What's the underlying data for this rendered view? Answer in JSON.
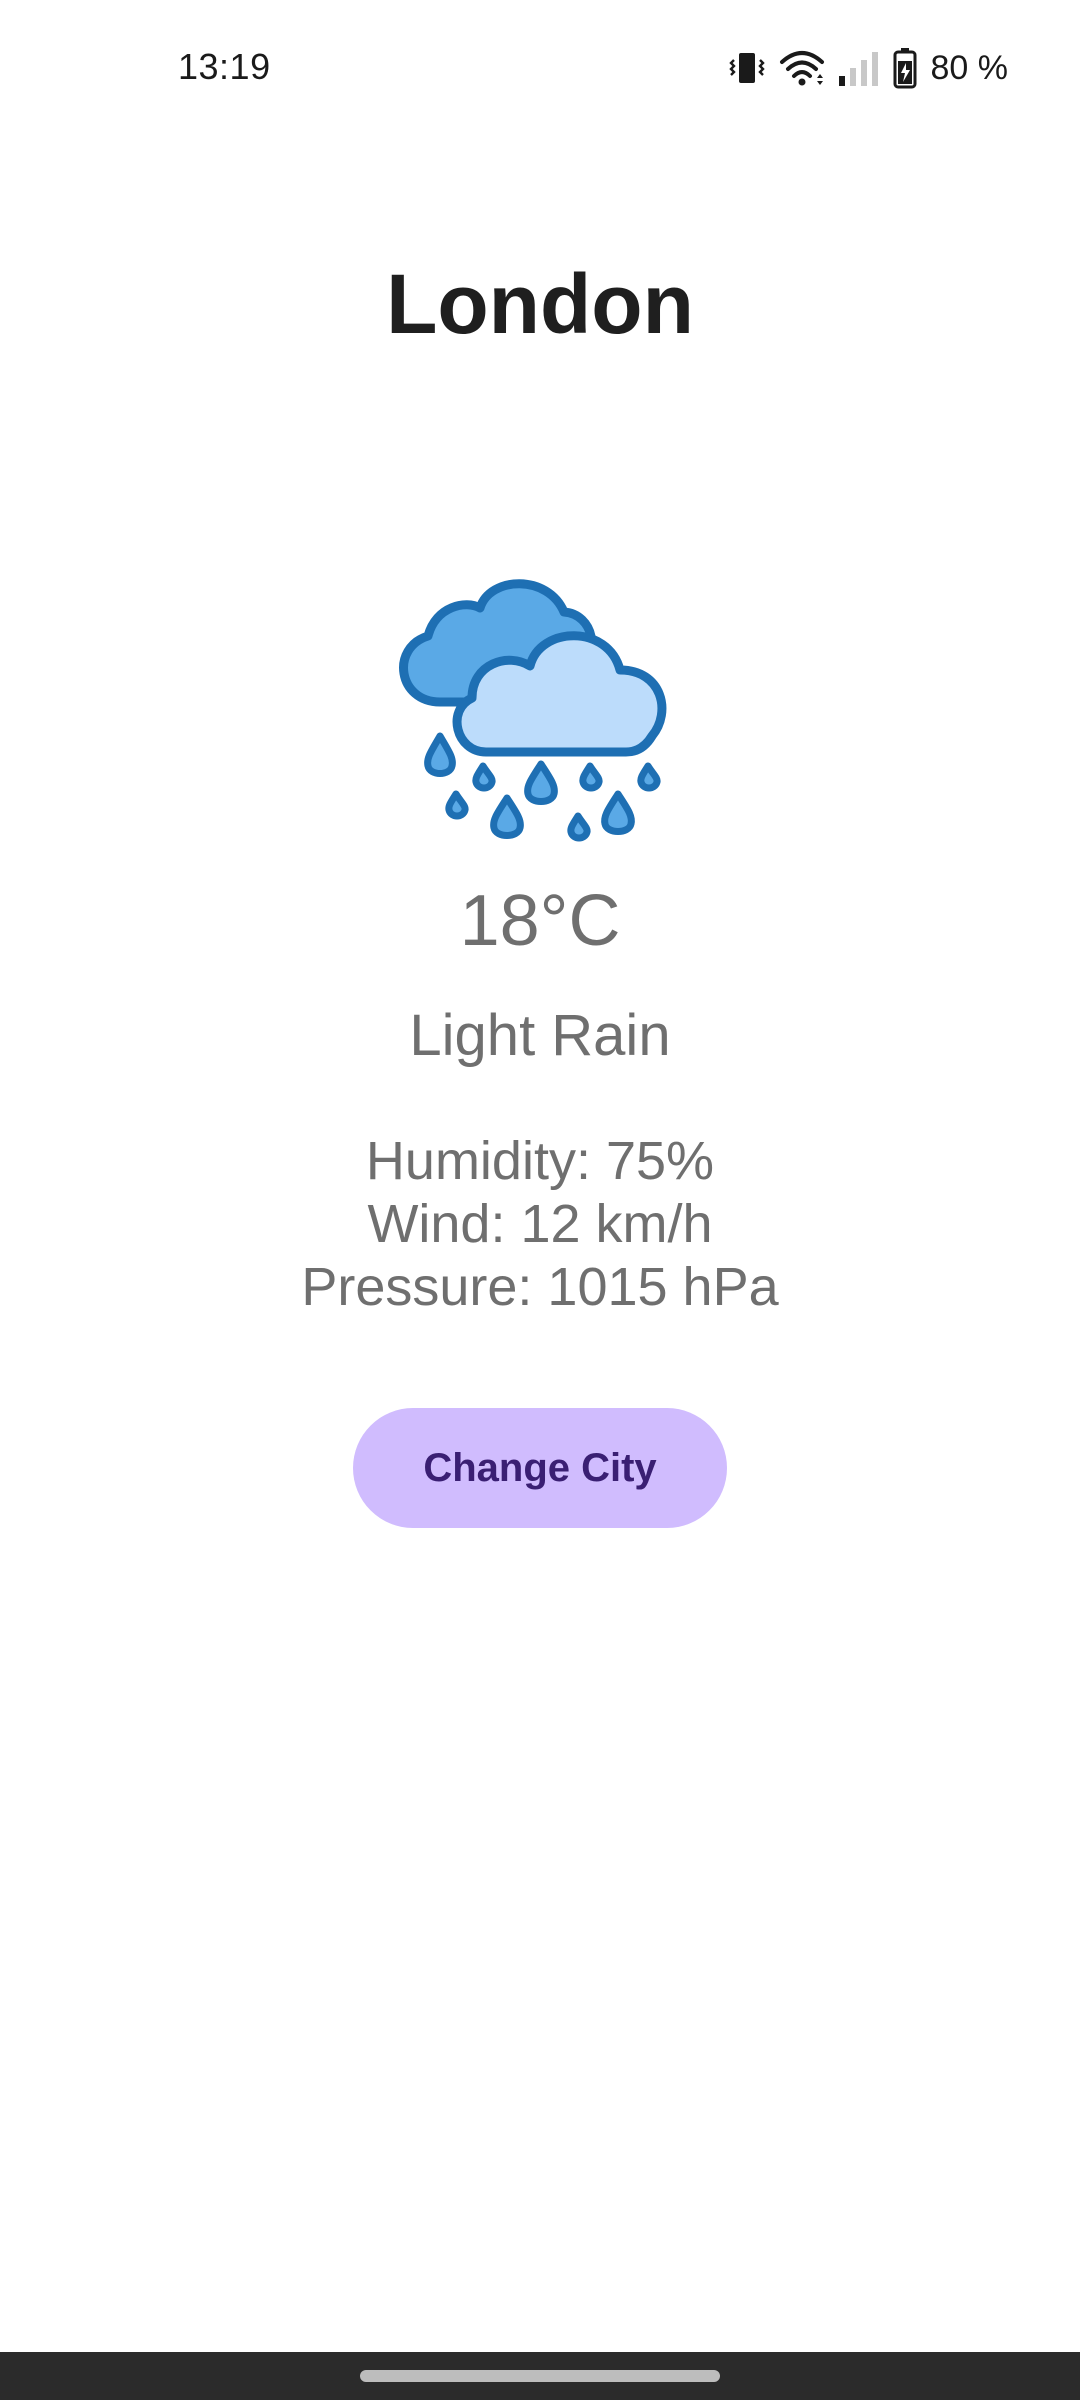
{
  "status_bar": {
    "time": "13:19",
    "battery_text": "80 %",
    "icons": [
      "vibrate-icon",
      "wifi-icon",
      "signal-icon",
      "battery-charging-icon"
    ]
  },
  "weather": {
    "city": "London",
    "temperature": "18°C",
    "condition": "Light Rain",
    "icon": "cloud-rain-icon",
    "details": {
      "humidity": "Humidity: 75%",
      "wind": "Wind: 12 km/h",
      "pressure": "Pressure: 1015 hPa"
    }
  },
  "actions": {
    "change_city_label": "Change City"
  },
  "colors": {
    "button_bg": "#d0bcfe",
    "button_text": "#3a1f73",
    "icon_dark_blue": "#1e6fb3",
    "icon_mid_blue": "#5aa9e6",
    "icon_light_blue": "#bcdcfb"
  }
}
